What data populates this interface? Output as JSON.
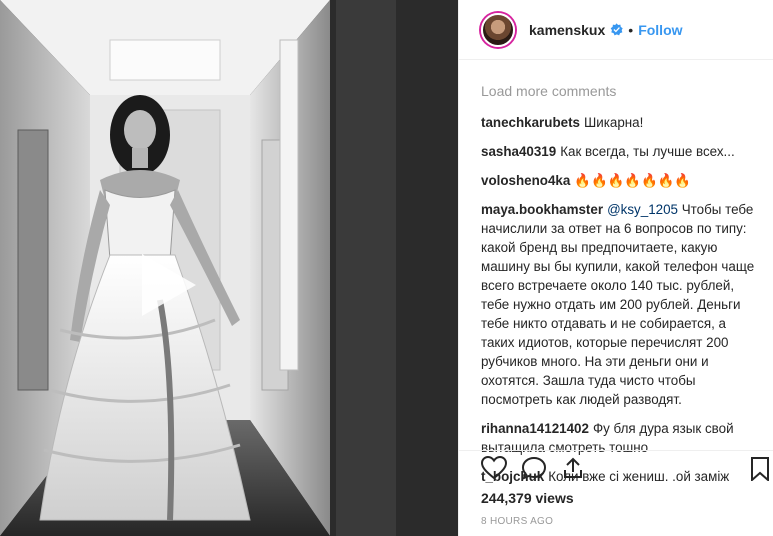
{
  "header": {
    "username": "kamenskux",
    "separator": "•",
    "follow_label": "Follow"
  },
  "comments": {
    "load_more": "Load more comments",
    "items": [
      {
        "user": "tanechkarubets",
        "text": "Шикарна!"
      },
      {
        "user": "sasha40319",
        "text": "Как всегда, ты лучше всех..."
      },
      {
        "user": "volosheno4ka",
        "text": "🔥🔥🔥🔥🔥🔥🔥"
      },
      {
        "user": "maya.bookhamster",
        "mention": "@ksy_1205",
        "text": "Чтобы тебе начислили за ответ на 6 вопросов по типу: какой бренд вы предпочитаете, какую машину вы бы купили, какой телефон чаще всего встречаете около 140 тыс. рублей, тебе нужно отдать им 200 рублей. Деньги тебе никто отдавать и не собирается, а таких идиотов, которые перечислят 200 рубчиков много. На эти деньги они и охотятся. Зашла туда чисто чтобы посмотреть как людей разводят."
      },
      {
        "user": "rihanna14121402",
        "text": "Фу бля дура язык свой вытащила смотреть тошно"
      },
      {
        "user": "t_bojchuk",
        "text": "Коли вже сі жениш. .ой заміж"
      }
    ]
  },
  "stats": {
    "views": "244,379 views",
    "time": "8 HOURS AGO"
  },
  "icons": {
    "like": "heart-icon",
    "comment": "comment-icon",
    "share": "share-icon",
    "save": "bookmark-icon",
    "verified": "verified-badge-icon",
    "play": "play-icon"
  },
  "colors": {
    "link": "#3897f0",
    "mention": "#003569",
    "muted": "#999999",
    "text": "#262626",
    "story_ring": "#d6249f"
  }
}
